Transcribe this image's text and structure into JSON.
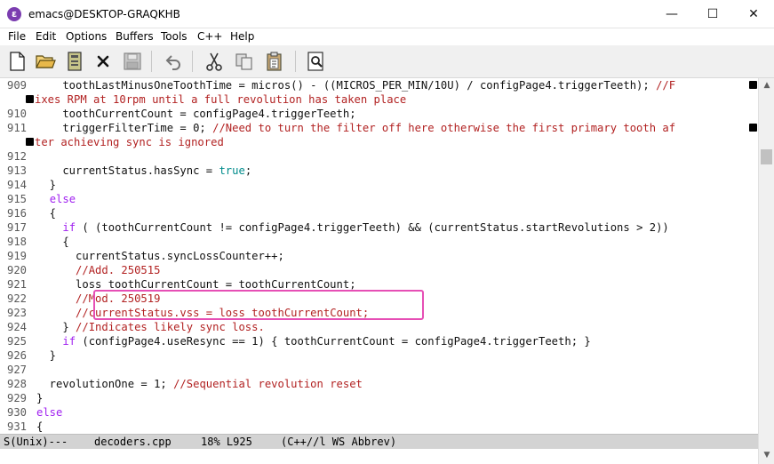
{
  "window": {
    "title": "emacs@DESKTOP-GRAQKHB",
    "app_icon_glyph": "ε",
    "minimize_glyph": "—",
    "maximize_glyph": "☐",
    "close_glyph": "✕"
  },
  "menu": [
    "File",
    "Edit",
    "Options",
    "Buffers",
    "Tools",
    "C++",
    "Help"
  ],
  "toolbar": {
    "buttons": [
      "new-file",
      "open-folder",
      "open-file",
      "close-buffer",
      "save",
      "undo",
      "cut",
      "copy",
      "paste",
      "search"
    ]
  },
  "code": [
    {
      "n": "909",
      "segs": [
        {
          "t": "    toothLastMinusOneToothTime = micros() - ((MICROS_PER_MIN/10U) / configPage4.triggerTeeth); ",
          "c": "n"
        },
        {
          "t": "//F",
          "c": "cmt"
        }
      ],
      "wrap": true
    },
    {
      "n": "",
      "segs": [
        {
          "t": "ixes RPM at 10rpm until a full revolution has taken place",
          "c": "cmt"
        }
      ],
      "cont": true
    },
    {
      "n": "910",
      "segs": [
        {
          "t": "    toothCurrentCount = configPage4.triggerTeeth;",
          "c": "n"
        }
      ]
    },
    {
      "n": "911",
      "segs": [
        {
          "t": "    triggerFilterTime = 0; ",
          "c": "n"
        },
        {
          "t": "//Need to turn the filter off here otherwise the first primary tooth af",
          "c": "cmt"
        }
      ],
      "wrap": true
    },
    {
      "n": "",
      "segs": [
        {
          "t": "ter achieving sync is ignored",
          "c": "cmt"
        }
      ],
      "cont": true
    },
    {
      "n": "912",
      "segs": [
        {
          "t": "",
          "c": "n"
        }
      ]
    },
    {
      "n": "913",
      "segs": [
        {
          "t": "    currentStatus.hasSync = ",
          "c": "n"
        },
        {
          "t": "true",
          "c": "cst"
        },
        {
          "t": ";",
          "c": "n"
        }
      ]
    },
    {
      "n": "914",
      "segs": [
        {
          "t": "  }",
          "c": "n"
        }
      ]
    },
    {
      "n": "915",
      "segs": [
        {
          "t": "  ",
          "c": "n"
        },
        {
          "t": "else",
          "c": "kw"
        }
      ]
    },
    {
      "n": "916",
      "segs": [
        {
          "t": "  {",
          "c": "n"
        }
      ]
    },
    {
      "n": "917",
      "segs": [
        {
          "t": "    ",
          "c": "n"
        },
        {
          "t": "if",
          "c": "kw"
        },
        {
          "t": " ( (toothCurrentCount != configPage4.triggerTeeth) && (currentStatus.startRevolutions > 2))",
          "c": "n"
        }
      ]
    },
    {
      "n": "918",
      "segs": [
        {
          "t": "    {",
          "c": "n"
        }
      ]
    },
    {
      "n": "919",
      "segs": [
        {
          "t": "      currentStatus.syncLossCounter++;",
          "c": "n"
        }
      ]
    },
    {
      "n": "920",
      "segs": [
        {
          "t": "      ",
          "c": "n"
        },
        {
          "t": "//Add. 250515",
          "c": "cmt"
        }
      ]
    },
    {
      "n": "921",
      "segs": [
        {
          "t": "      loss toothCurrentCount = toothCurrentCount;",
          "c": "n"
        }
      ]
    },
    {
      "n": "922",
      "segs": [
        {
          "t": "      ",
          "c": "n"
        },
        {
          "t": "//Mod. 250519",
          "c": "cmt"
        }
      ]
    },
    {
      "n": "923",
      "segs": [
        {
          "t": "      ",
          "c": "n"
        },
        {
          "t": "//currentStatus.vss = loss toothCurrentCount;",
          "c": "cmt"
        }
      ]
    },
    {
      "n": "924",
      "segs": [
        {
          "t": "    } ",
          "c": "n"
        },
        {
          "t": "//Indicates likely sync loss.",
          "c": "cmt"
        }
      ]
    },
    {
      "n": "925",
      "segs": [
        {
          "t": "    ",
          "c": "n"
        },
        {
          "t": "if",
          "c": "kw"
        },
        {
          "t": " (configPage4.useResync == 1) { toothCurrentCount = configPage4.triggerTeeth; }",
          "c": "n"
        }
      ]
    },
    {
      "n": "926",
      "segs": [
        {
          "t": "  }",
          "c": "n"
        }
      ]
    },
    {
      "n": "927",
      "segs": [
        {
          "t": "",
          "c": "n"
        }
      ]
    },
    {
      "n": "928",
      "segs": [
        {
          "t": "  revolutionOne = 1; ",
          "c": "n"
        },
        {
          "t": "//Sequential revolution reset",
          "c": "cmt"
        }
      ]
    },
    {
      "n": "929",
      "segs": [
        {
          "t": "}",
          "c": "n"
        }
      ]
    },
    {
      "n": "930",
      "segs": [
        {
          "t": "",
          "c": "n"
        },
        {
          "t": "else",
          "c": "kw"
        }
      ]
    },
    {
      "n": "931",
      "segs": [
        {
          "t": "{",
          "c": "n"
        }
      ]
    }
  ],
  "modeline": {
    "status": "S(Unix)---",
    "buffer": "decoders.cpp",
    "position": "18% L925",
    "modes": "(C++//l WS Abbrev)"
  },
  "colors": {
    "keyword": "#a020f0",
    "constant": "#008b8b",
    "comment": "#b22222",
    "highlight_box": "#e64fb5",
    "modeline_bg": "#d3d3d3"
  }
}
